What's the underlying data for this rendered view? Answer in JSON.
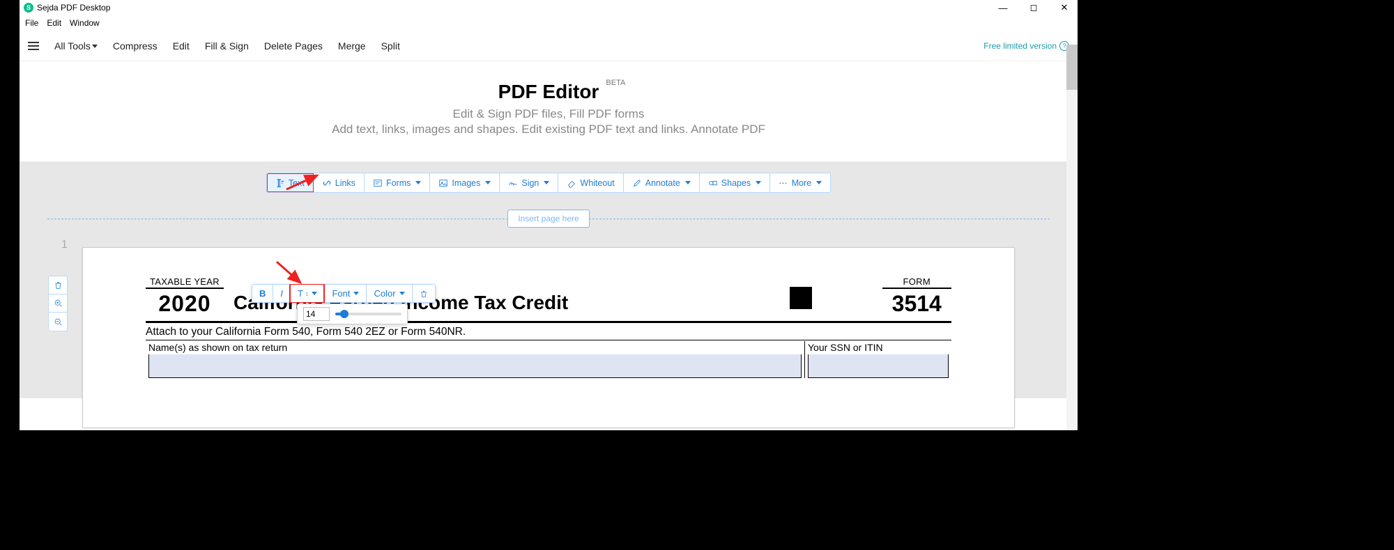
{
  "window": {
    "title": "Sejda PDF Desktop"
  },
  "menubar": {
    "file": "File",
    "edit": "Edit",
    "window": "Window"
  },
  "appbar": {
    "all_tools": "All Tools",
    "compress": "Compress",
    "edit": "Edit",
    "fill_sign": "Fill & Sign",
    "delete_pages": "Delete Pages",
    "merge": "Merge",
    "split": "Split",
    "free_version": "Free limited version"
  },
  "hero": {
    "title": "PDF Editor",
    "beta": "BETA",
    "subtitle": "Edit & Sign PDF files, Fill PDF forms",
    "desc": "Add text, links, images and shapes. Edit existing PDF text and links. Annotate PDF"
  },
  "edit_toolbar": {
    "text": "Text",
    "links": "Links",
    "forms": "Forms",
    "images": "Images",
    "sign": "Sign",
    "whiteout": "Whiteout",
    "annotate": "Annotate",
    "shapes": "Shapes",
    "more": "More"
  },
  "insert": {
    "label": "Insert page here"
  },
  "page": {
    "number": "1",
    "taxable_year_label": "TAXABLE YEAR",
    "year": "2020",
    "form_title": "California Earned Income Tax Credit",
    "form_label": "FORM",
    "form_number": "3514",
    "attach": "Attach to your California Form 540, Form 540 2EZ or Form 540NR.",
    "names_label": "Name(s) as shown on tax return",
    "ssn_label": "Your SSN or ITIN"
  },
  "float_toolbar": {
    "bold": "B",
    "italic": "I",
    "size_label": "T",
    "font": "Font",
    "color": "Color"
  },
  "size_popover": {
    "value": "14"
  }
}
